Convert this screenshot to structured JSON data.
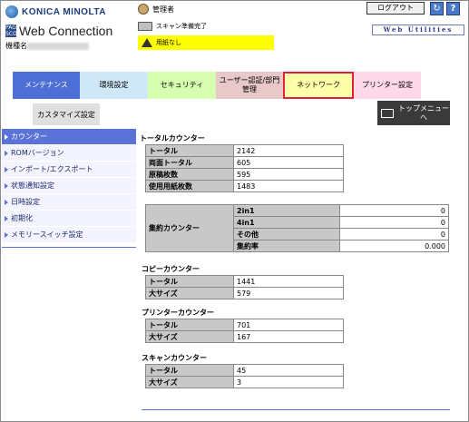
{
  "header": {
    "brand": "KONICA MINOLTA",
    "pagescope_small": "PAGE SCOPE",
    "product": "Web Connection",
    "device_label": "機種名",
    "user": "管理者",
    "scan_status": "スキャン準備完了",
    "warning": "用紙なし",
    "logout": "ログアウト",
    "refresh_icon": "refresh-icon",
    "help_icon": "help-icon",
    "web_utilities": "Web Utilities"
  },
  "tabs": [
    {
      "label": "メンテナンス"
    },
    {
      "label": "環境設定"
    },
    {
      "label": "セキュリティ"
    },
    {
      "label": "ユーザー認証/部門管理"
    },
    {
      "label": "ネットワーク"
    },
    {
      "label": "プリンター設定"
    }
  ],
  "tab_custom": "カスタマイズ設定",
  "top_menu": "トップメニューへ",
  "nav": [
    {
      "label": "カウンター"
    },
    {
      "label": "ROMバージョン"
    },
    {
      "label": "インポート/エクスポート"
    },
    {
      "label": "状態通知設定"
    },
    {
      "label": "日時設定"
    },
    {
      "label": "初期化"
    },
    {
      "label": "メモリースイッチ設定"
    }
  ],
  "total": {
    "title": "トータルカウンター",
    "rows": [
      {
        "label": "トータル",
        "value": "2142"
      },
      {
        "label": "両面トータル",
        "value": "605"
      },
      {
        "label": "原稿枚数",
        "value": "595"
      },
      {
        "label": "使用用紙枚数",
        "value": "1483"
      }
    ]
  },
  "aggregate": {
    "label": "集約カウンター",
    "rows": [
      {
        "label": "2in1",
        "value": "0"
      },
      {
        "label": "4in1",
        "value": "0"
      },
      {
        "label": "その他",
        "value": "0"
      },
      {
        "label": "集約率",
        "value": "0.000"
      }
    ]
  },
  "copy": {
    "title": "コピーカウンター",
    "rows": [
      {
        "label": "トータル",
        "value": "1441"
      },
      {
        "label": "大サイズ",
        "value": "579"
      }
    ]
  },
  "printer": {
    "title": "プリンターカウンター",
    "rows": [
      {
        "label": "トータル",
        "value": "701"
      },
      {
        "label": "大サイズ",
        "value": "167"
      }
    ]
  },
  "scan": {
    "title": "スキャンカウンター",
    "rows": [
      {
        "label": "トータル",
        "value": "45"
      },
      {
        "label": "大サイズ",
        "value": "3"
      }
    ]
  }
}
